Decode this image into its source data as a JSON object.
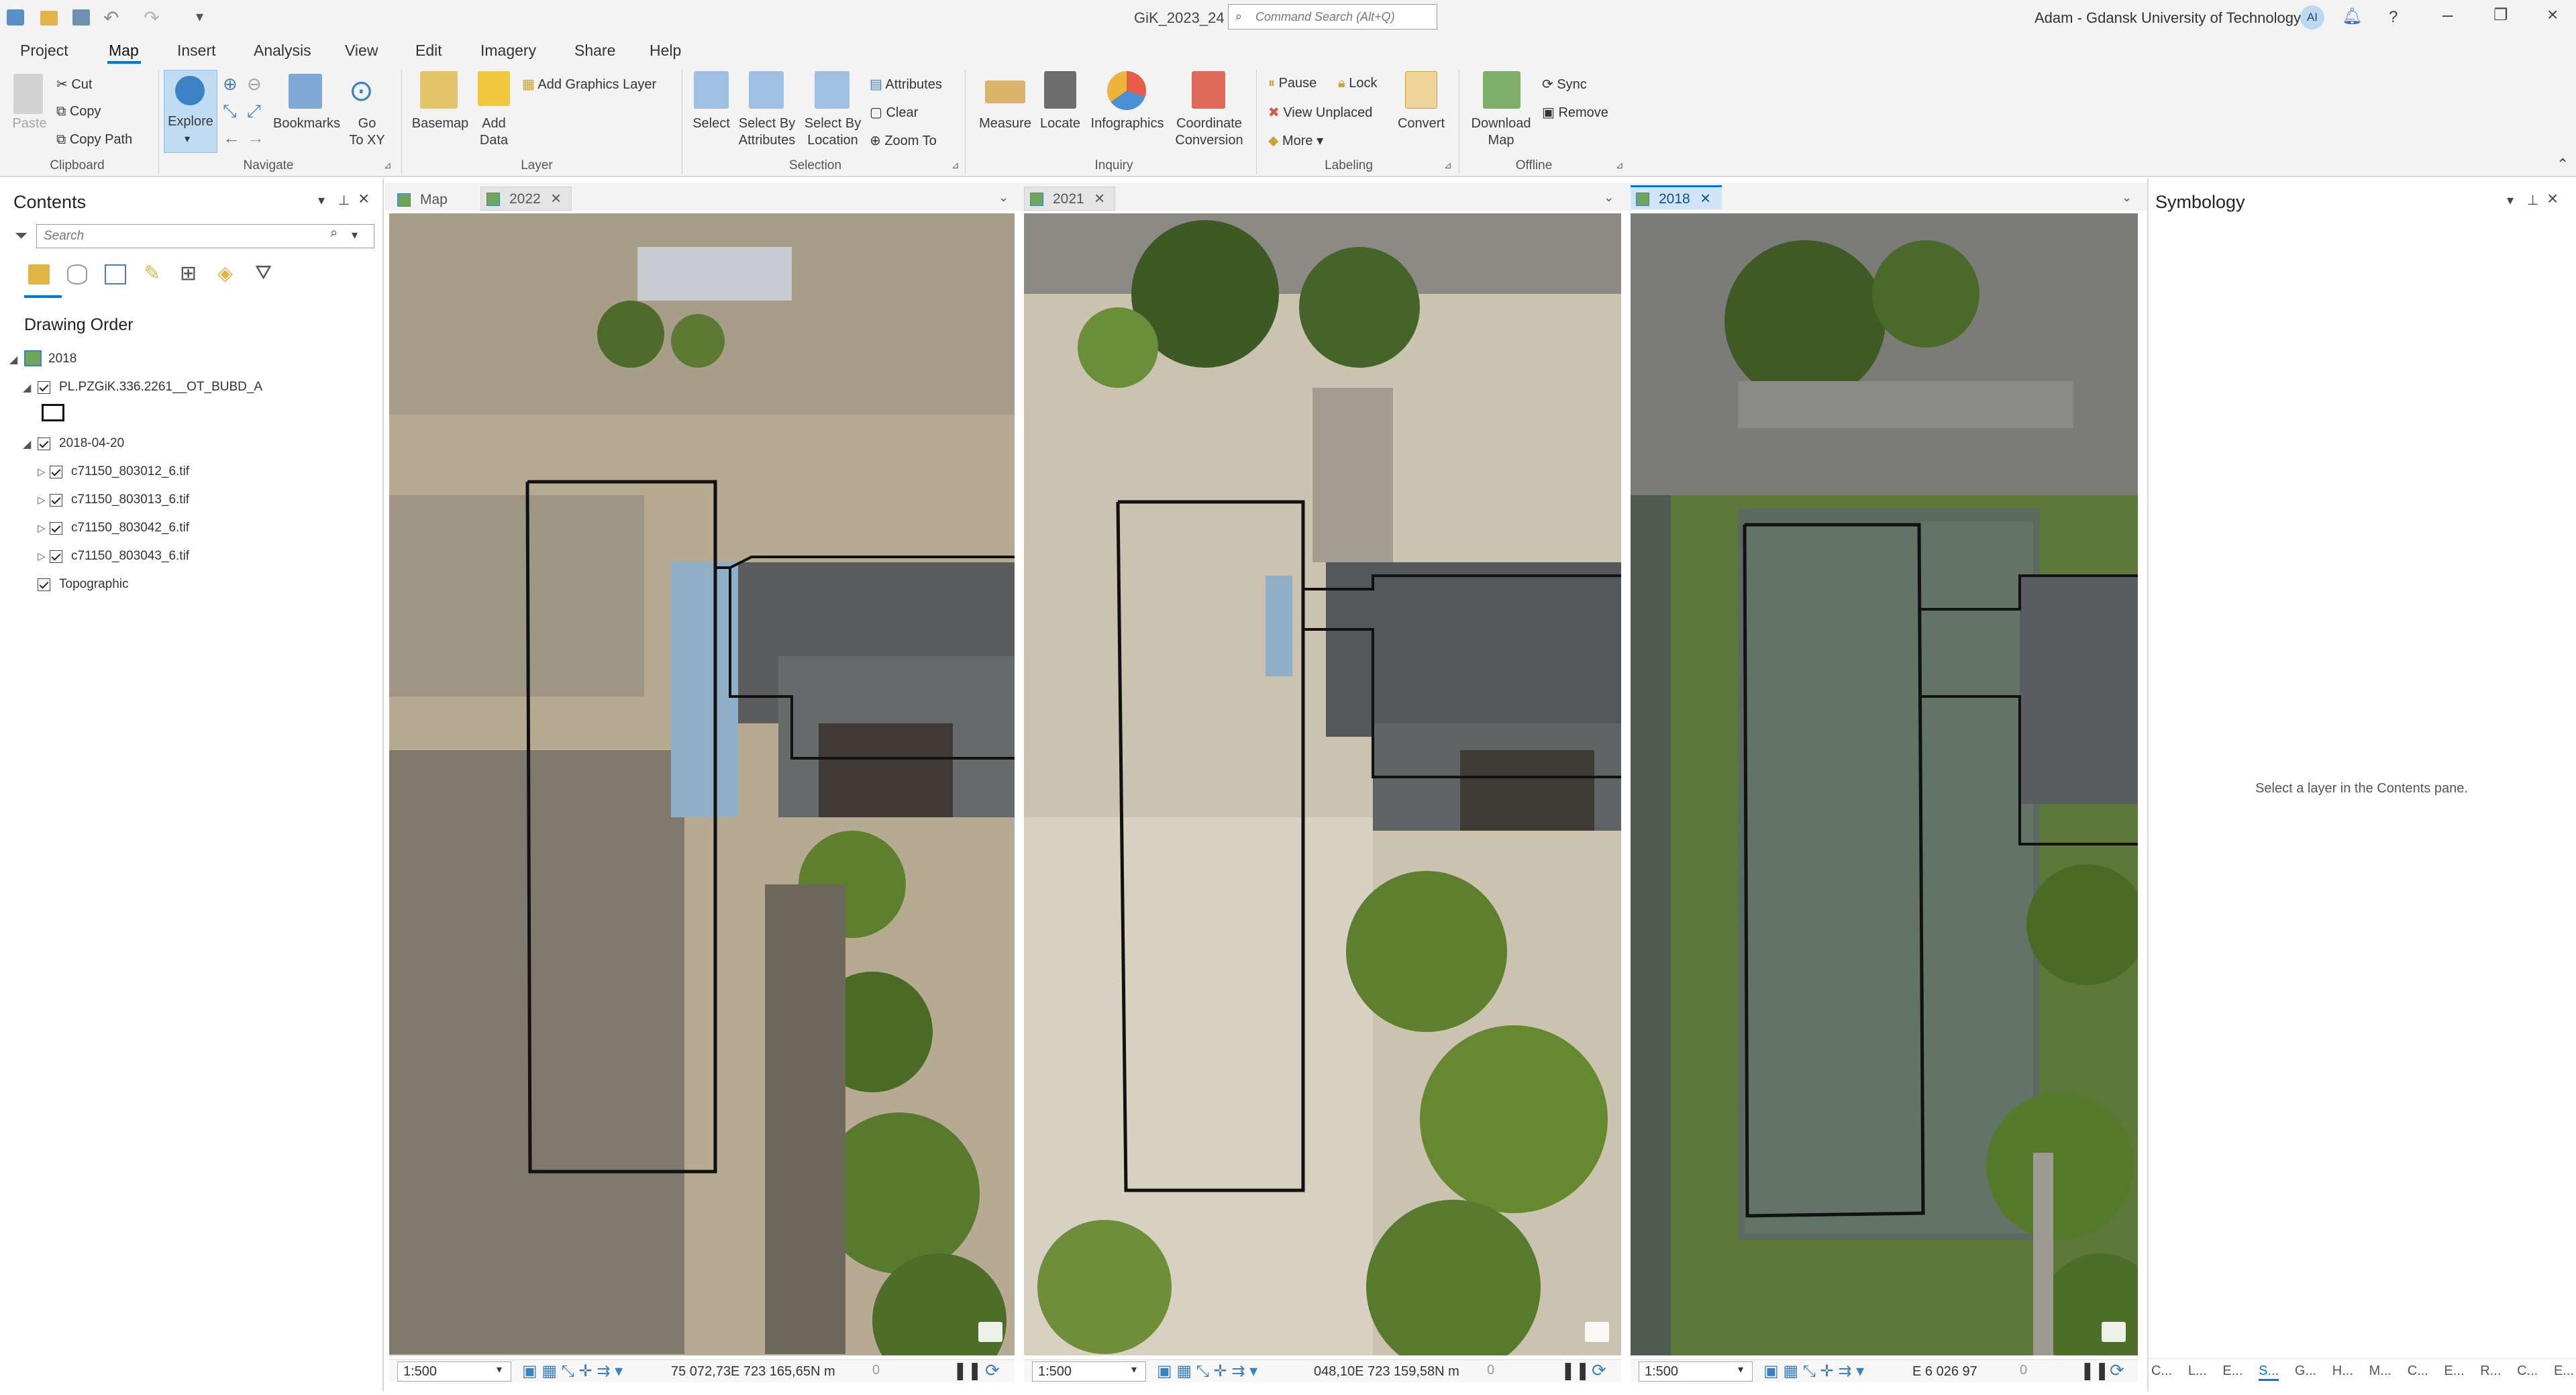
{
  "titlebar": {
    "project": "GiK_2023_24",
    "command_search": "Command Search (Alt+Q)",
    "user": "Adam - Gdansk University of Technology",
    "avatar": "AI",
    "help": "?"
  },
  "menu": [
    "Project",
    "Map",
    "Insert",
    "Analysis",
    "View",
    "Edit",
    "Imagery",
    "Share",
    "Help"
  ],
  "ribbon": {
    "clipboard": {
      "group": "Clipboard",
      "paste": "Paste",
      "cut": "Cut",
      "copy": "Copy",
      "copy_path": "Copy Path"
    },
    "navigate": {
      "group": "Navigate",
      "explore": "Explore",
      "bookmarks": "Bookmarks",
      "go_to_xy": "Go\nTo XY"
    },
    "layer": {
      "group": "Layer",
      "basemap": "Basemap",
      "add_data": "Add\nData",
      "add_graphics_layer": "Add Graphics Layer"
    },
    "selection": {
      "group": "Selection",
      "select": "Select",
      "select_by_attributes": "Select By\nAttributes",
      "select_by_location": "Select By\nLocation",
      "attributes": "Attributes",
      "clear": "Clear",
      "zoom_to": "Zoom To"
    },
    "inquiry": {
      "group": "Inquiry",
      "measure": "Measure",
      "locate": "Locate",
      "infographics": "Infographics",
      "coordinate_conversion": "Coordinate\nConversion"
    },
    "labeling": {
      "group": "Labeling",
      "pause": "Pause",
      "lock": "Lock",
      "view_unplaced": "View Unplaced",
      "more": "More",
      "convert": "Convert"
    },
    "offline": {
      "group": "Offline",
      "download_map": "Download\nMap",
      "sync": "Sync",
      "remove": "Remove"
    }
  },
  "contents": {
    "title": "Contents",
    "search_placeholder": "Search",
    "drawing_order": "Drawing Order",
    "tree": {
      "map": "2018",
      "layer1": "PL.PZGiK.336.2261__OT_BUBD_A",
      "group": "2018-04-20",
      "tiles": [
        "c71150_803012_6.tif",
        "c71150_803013_6.tif",
        "c71150_803042_6.tif",
        "c71150_803043_6.tif"
      ],
      "basemap": "Topographic"
    }
  },
  "views": [
    {
      "tabs": [
        "Map",
        "2022"
      ],
      "scale": "1:500",
      "coords": "75 072,73E 723 165,65N m"
    },
    {
      "tabs": [
        "2021"
      ],
      "scale": "1:500",
      "coords": "048,10E 723 159,58N m"
    },
    {
      "tabs": [
        "2018"
      ],
      "scale": "1:500",
      "coords": "E 6 026 97"
    }
  ],
  "status_count": "0",
  "symbology": {
    "title": "Symbology",
    "message": "Select a layer in the Contents pane.",
    "bottom_tabs": [
      "C...",
      "L...",
      "E...",
      "S...",
      "G...",
      "H...",
      "M...",
      "C...",
      "E...",
      "R...",
      "C...",
      "E..."
    ]
  },
  "colors": {
    "accent": "#0078d4",
    "active_tool": "#bfdcf3"
  }
}
